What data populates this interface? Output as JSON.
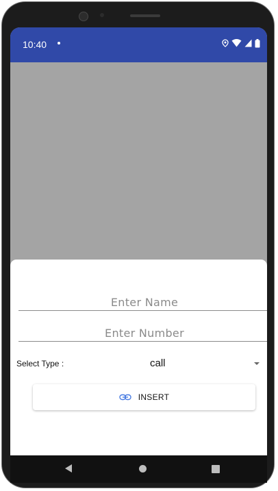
{
  "status_bar": {
    "time": "10:40",
    "icons": [
      "notification-dot-icon",
      "location-icon",
      "wifi-icon",
      "cell-signal-icon",
      "battery-icon"
    ]
  },
  "colors": {
    "status_bar": "#3049a8",
    "overlay": "#a4a4a4",
    "sheet": "#ffffff",
    "link_icon": "#4a7de2"
  },
  "form": {
    "name_placeholder": "Enter Name",
    "number_placeholder": "Enter Number",
    "select_label": "Select Type :",
    "select_value": "call",
    "insert_label": "INSERT",
    "insert_icon": "link-icon"
  },
  "navigation": {
    "buttons": [
      "back-icon",
      "home-icon",
      "recents-icon"
    ]
  }
}
